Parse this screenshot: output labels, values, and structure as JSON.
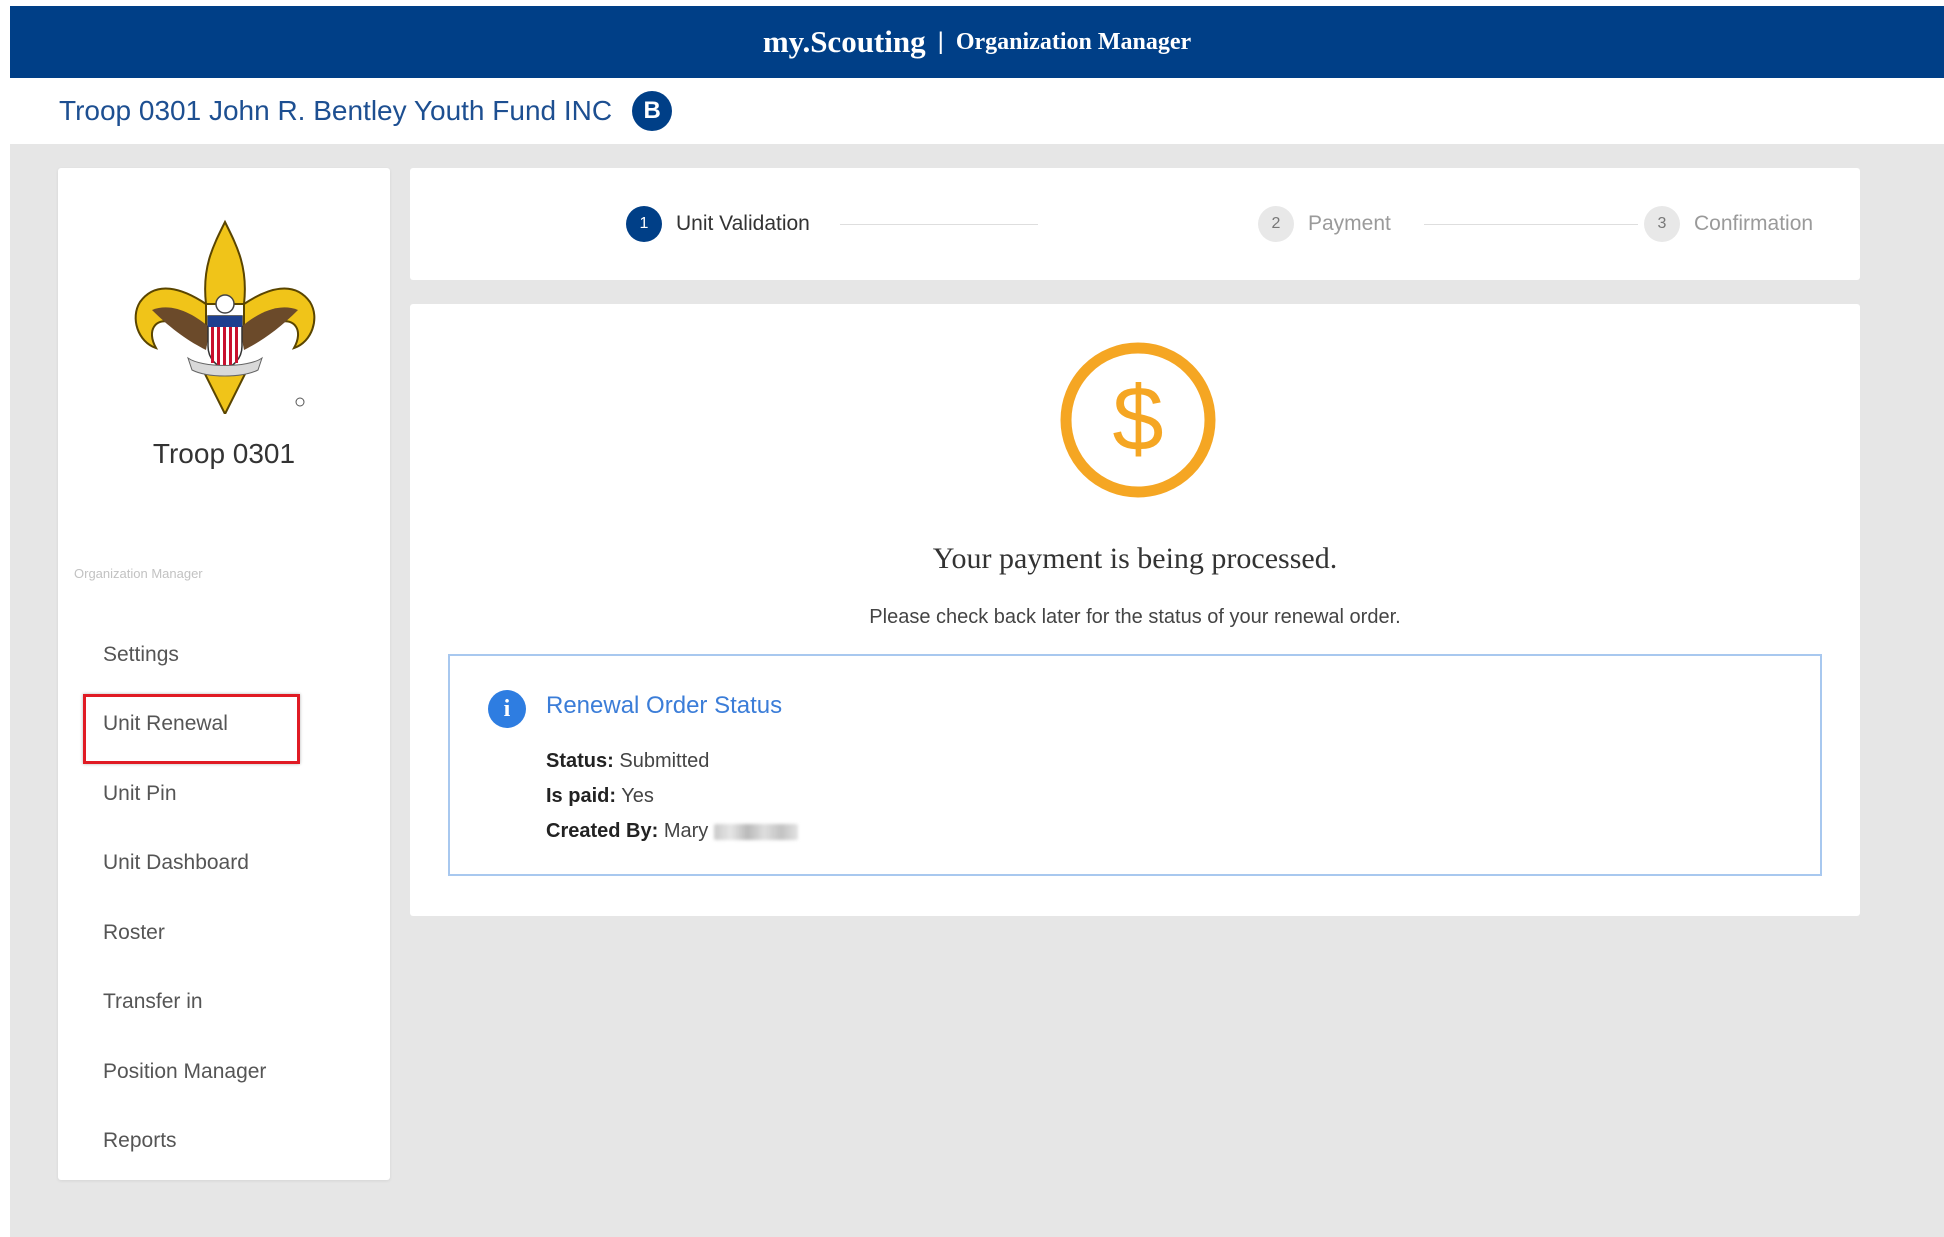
{
  "header": {
    "brand": "my.Scouting",
    "separator": "|",
    "subtitle": "Organization Manager"
  },
  "org": {
    "name": "Troop 0301 John R. Bentley Youth Fund INC",
    "badge": "B"
  },
  "sidebar": {
    "logo_icon": "scouting-fleur-de-lis-logo",
    "troop_label": "Troop 0301",
    "section_label": "Organization Manager",
    "highlighted_item": "Unit Renewal",
    "highlight_color": "#e01b24",
    "items": [
      {
        "label": "Settings"
      },
      {
        "label": "Unit Renewal"
      },
      {
        "label": "Unit Pin"
      },
      {
        "label": "Unit Dashboard"
      },
      {
        "label": "Roster"
      },
      {
        "label": "Transfer in"
      },
      {
        "label": "Position Manager"
      },
      {
        "label": "Reports"
      }
    ]
  },
  "stepper": {
    "active_step": 1,
    "steps": [
      {
        "number": "1",
        "label": "Unit Validation"
      },
      {
        "number": "2",
        "label": "Payment"
      },
      {
        "number": "3",
        "label": "Confirmation"
      }
    ]
  },
  "main": {
    "icon": "dollar-circle-icon",
    "headline": "Your payment is being processed.",
    "subtext": "Please check back later for the status of your renewal order."
  },
  "status_box": {
    "icon": "info-icon",
    "title": "Renewal Order Status",
    "status_label": "Status:",
    "status_value": "Submitted",
    "paid_label": "Is paid:",
    "paid_value": "Yes",
    "created_label": "Created By:",
    "created_value": "Mary"
  },
  "colors": {
    "navy": "#003f87",
    "accent_gold": "#f5a623",
    "info_blue": "#2e7de1",
    "link_blue": "#3b7dd8"
  }
}
